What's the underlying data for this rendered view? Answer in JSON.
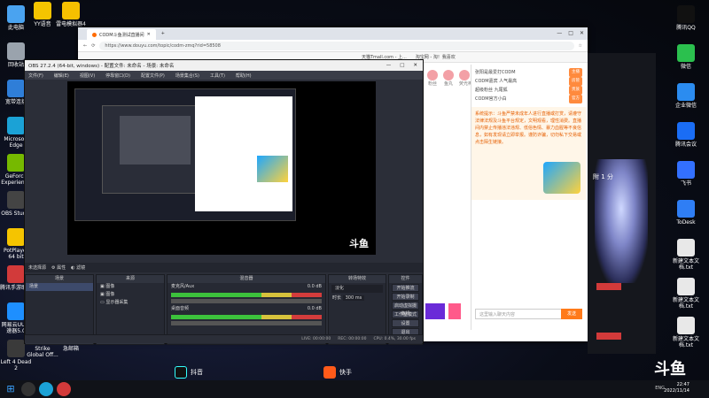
{
  "desktop_icons_left": [
    {
      "label": "此电脑",
      "color": "#4aa3f0"
    },
    {
      "label": "回收站",
      "color": "#9aa3ad"
    },
    {
      "label": "宽带连接",
      "color": "#2f7ed8"
    },
    {
      "label": "Microsoft Edge",
      "color": "#1ba2d6"
    },
    {
      "label": "GeForce Experience",
      "color": "#76b900"
    },
    {
      "label": "OBS Studio",
      "color": "#444"
    },
    {
      "label": "PotPlayer 64 bit",
      "color": "#f5c400"
    },
    {
      "label": "腾讯手游助手",
      "color": "#d23a3a"
    },
    {
      "label": "网易云UU加速器5.0",
      "color": "#1e8fff"
    },
    {
      "label": "Left 4 Dead 2",
      "color": "#3a3a3a"
    }
  ],
  "desktop_icons_col2": [
    {
      "label": "YY语音",
      "color": "#f5c400"
    },
    {
      "label": "Counter-Strike Global Off...",
      "color": "#c8a04a"
    }
  ],
  "desktop_icons_col3": [
    {
      "label": "雷电模拟器4",
      "color": "#f6c000"
    },
    {
      "label": "最大乘 翻邮 急邮箱",
      "color": "#d23a3a"
    }
  ],
  "desktop_icons_right": [
    {
      "label": "腾讯QQ",
      "color": "#111"
    },
    {
      "label": "微信",
      "color": "#2bc04e"
    },
    {
      "label": "企业微信",
      "color": "#2b8cf0"
    },
    {
      "label": "腾讯会议",
      "color": "#1a6df5"
    },
    {
      "label": "飞书",
      "color": "#3370ff"
    },
    {
      "label": "ToDesk",
      "color": "#2f7ef5"
    },
    {
      "label": "新建文本文档.txt",
      "color": "#e8e8e8"
    },
    {
      "label": "新建文本文档.txt",
      "color": "#e8e8e8"
    },
    {
      "label": "新建文本文档.txt",
      "color": "#e8e8e8"
    }
  ],
  "browser": {
    "tab_title": "CODM斗鱼测试直播间",
    "url": "https://www.douyu.com/topic/codm-zmq?rid=58508",
    "bookmarks": [
      "天猫Tmall.com - 上...",
      "淘宝网 - 淘！我喜欢"
    ],
    "controls": [
      "—",
      "□",
      "✕"
    ]
  },
  "douyu": {
    "gift_labels": [
      "粉丝",
      "鱼丸",
      "荧光棒",
      "火箭"
    ],
    "rank_items": [
      {
        "text": "张阳是最爱打CODM",
        "tag": "主播"
      },
      {
        "text": "CODM嘉宾  人气最高",
        "tag": "房管"
      },
      {
        "text": "超级粉丝  九尾狐",
        "tag": "贵族"
      },
      {
        "text": "CODM官方小白",
        "tag": "官方"
      }
    ],
    "notice": "系统提示：斗鱼严禁未成年人进行直播或打赏，请遵守法律法规及斗鱼平台规定，文明观看，理性消费。直播间内禁止传播违法违规、低俗色情、暴力血腥等不良信息，如有发现请立即举报。谨防诈骗，切勿私下交易或点击陌生链接。",
    "input_placeholder": "这里输入聊天内容",
    "send_label": "发送",
    "brand": "斗鱼"
  },
  "obs": {
    "window_title": "OBS 27.2.4 (64-bit, windows) - 配置文件: 未命名 - 场景: 未命名",
    "menu": [
      "文件(F)",
      "编辑(E)",
      "视图(V)",
      "停靠窗口(D)",
      "配置文件(P)",
      "场景集合(S)",
      "工具(T)",
      "帮助(H)"
    ],
    "scene_bar": [
      "未选择源",
      "属性",
      "滤镜"
    ],
    "docks": {
      "scenes": {
        "title": "场景",
        "items": [
          "场景"
        ]
      },
      "sources": {
        "title": "来源",
        "items": [
          "图像",
          "图像",
          "显示器采集"
        ]
      },
      "mixer": {
        "title": "混音器",
        "channels": [
          {
            "name": "麦克风/Aux",
            "db": "0.0 dB"
          },
          {
            "name": "桌面音频",
            "db": "0.0 dB"
          }
        ]
      },
      "transitions": {
        "title": "转场特效",
        "type": "淡化",
        "duration_label": "时长",
        "duration": "300 ms"
      },
      "controls": {
        "title": "控件",
        "buttons": [
          "开始推流",
          "开始录制",
          "启动虚拟摄像机",
          "工作室模式",
          "设置",
          "退出"
        ]
      }
    },
    "status": {
      "live": "LIVE: 00:00:00",
      "rec": "REC: 00:00:00",
      "cpu": "CPU: 0.4%, 30.00 fps"
    }
  },
  "right_panel": {
    "score_text": "附 1 分"
  },
  "taskbar": {
    "time": "22:47",
    "date": "2022/11/14",
    "lang": "ENG"
  },
  "logos": {
    "douyu_mark": "斗鱼",
    "douyin": "抖音",
    "kuaishou": "快手"
  }
}
